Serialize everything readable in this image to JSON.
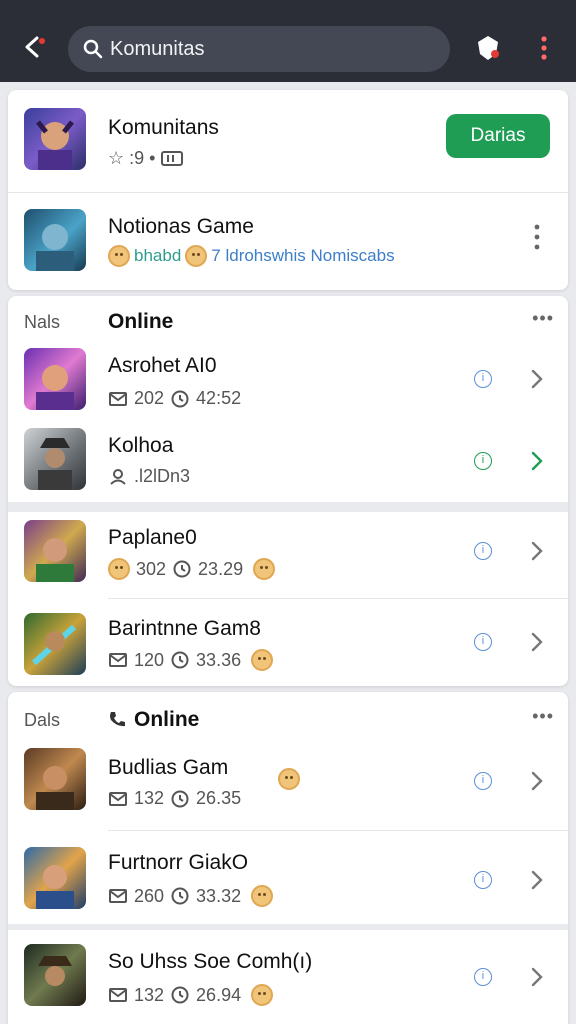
{
  "header": {
    "search_placeholder": "Komunitas",
    "back_icon": "chevron-left-icon",
    "action_icons": [
      "shield-icon",
      "kebab-icon"
    ],
    "colors": {
      "bar": "#2b2e36",
      "search": "#444854"
    }
  },
  "top_card": {
    "community": {
      "name": "Komunitans",
      "rating": "☆ :9 •",
      "join_label": "Darias"
    },
    "game": {
      "name": "Notionas Game",
      "tag1": "bhabd",
      "tag2": "7 ldrohswhis Nomiscabs"
    }
  },
  "section1": {
    "label": "Nals",
    "title": "Online",
    "more": "•••",
    "items": [
      {
        "name": "Asrohet AI0",
        "count": "202",
        "time": "42:52",
        "face": false,
        "accent": "blue"
      },
      {
        "name": "Kolhoa",
        "count": ".l2lDn3",
        "time": "",
        "face": false,
        "accent": "green"
      },
      {
        "name": "Paplane0",
        "count": "302",
        "time": "23.29",
        "face": true,
        "accent": "blue"
      },
      {
        "name": "Barintnne Gam8",
        "count": "120",
        "time": "33.36",
        "face": true,
        "accent": "blue"
      }
    ]
  },
  "section2": {
    "label": "Dals",
    "title": "Online",
    "more": "•••",
    "items": [
      {
        "name": "Budlias Gam",
        "count": "132",
        "time": "26.35",
        "face": true
      },
      {
        "name": "Furtnorr GiakO",
        "count": "260",
        "time": "33.32",
        "face": true
      },
      {
        "name": "So Uhss Soe Comh(ı)",
        "count": "132",
        "time": "26.94",
        "face": true
      }
    ]
  }
}
